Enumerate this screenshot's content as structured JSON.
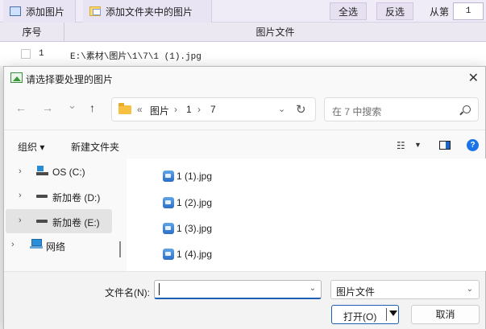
{
  "app": {
    "toolbar": {
      "add_image": "添加图片",
      "add_folder_images": "添加文件夹中的图片",
      "select_all": "全选",
      "invert_select": "反选",
      "from_label": "从第",
      "from_value": "1"
    },
    "grid": {
      "col_index": "序号",
      "col_file": "图片文件",
      "rows": [
        {
          "index": "1",
          "path": "E:\\素材\\图片\\1\\7\\1 (1).jpg"
        }
      ]
    }
  },
  "dialog": {
    "title": "请选择要处理的图片",
    "close": "✕",
    "nav": {
      "back": "←",
      "forward": "→",
      "recent": "⌄",
      "up": "↑"
    },
    "address": {
      "overflow": "«",
      "crumbs": [
        "图片",
        "1",
        "7"
      ],
      "separator": "›",
      "dropdown": "⌄",
      "refresh": "↻"
    },
    "search_placeholder": "在 7 中搜索",
    "commands": {
      "organize": "组织 ▾",
      "new_folder": "新建文件夹",
      "view_icon": "☷",
      "view_dropdown": "▼",
      "help": "?"
    },
    "tree": [
      {
        "label": "OS (C:)",
        "chevron": "›"
      },
      {
        "label": "新加卷 (D:)",
        "chevron": "›"
      },
      {
        "label": "新加卷 (E:)",
        "chevron": "›"
      },
      {
        "label": "网络",
        "chevron": "›"
      }
    ],
    "files": [
      "1 (1).jpg",
      "1 (2).jpg",
      "1 (3).jpg",
      "1 (4).jpg"
    ],
    "filename_label": "文件名(N):",
    "filename_value": "",
    "filename_dropdown": "⌄",
    "filetype_value": "图片文件",
    "filetype_dropdown": "⌄",
    "open_label": "打开(O)",
    "cancel_label": "取消"
  }
}
